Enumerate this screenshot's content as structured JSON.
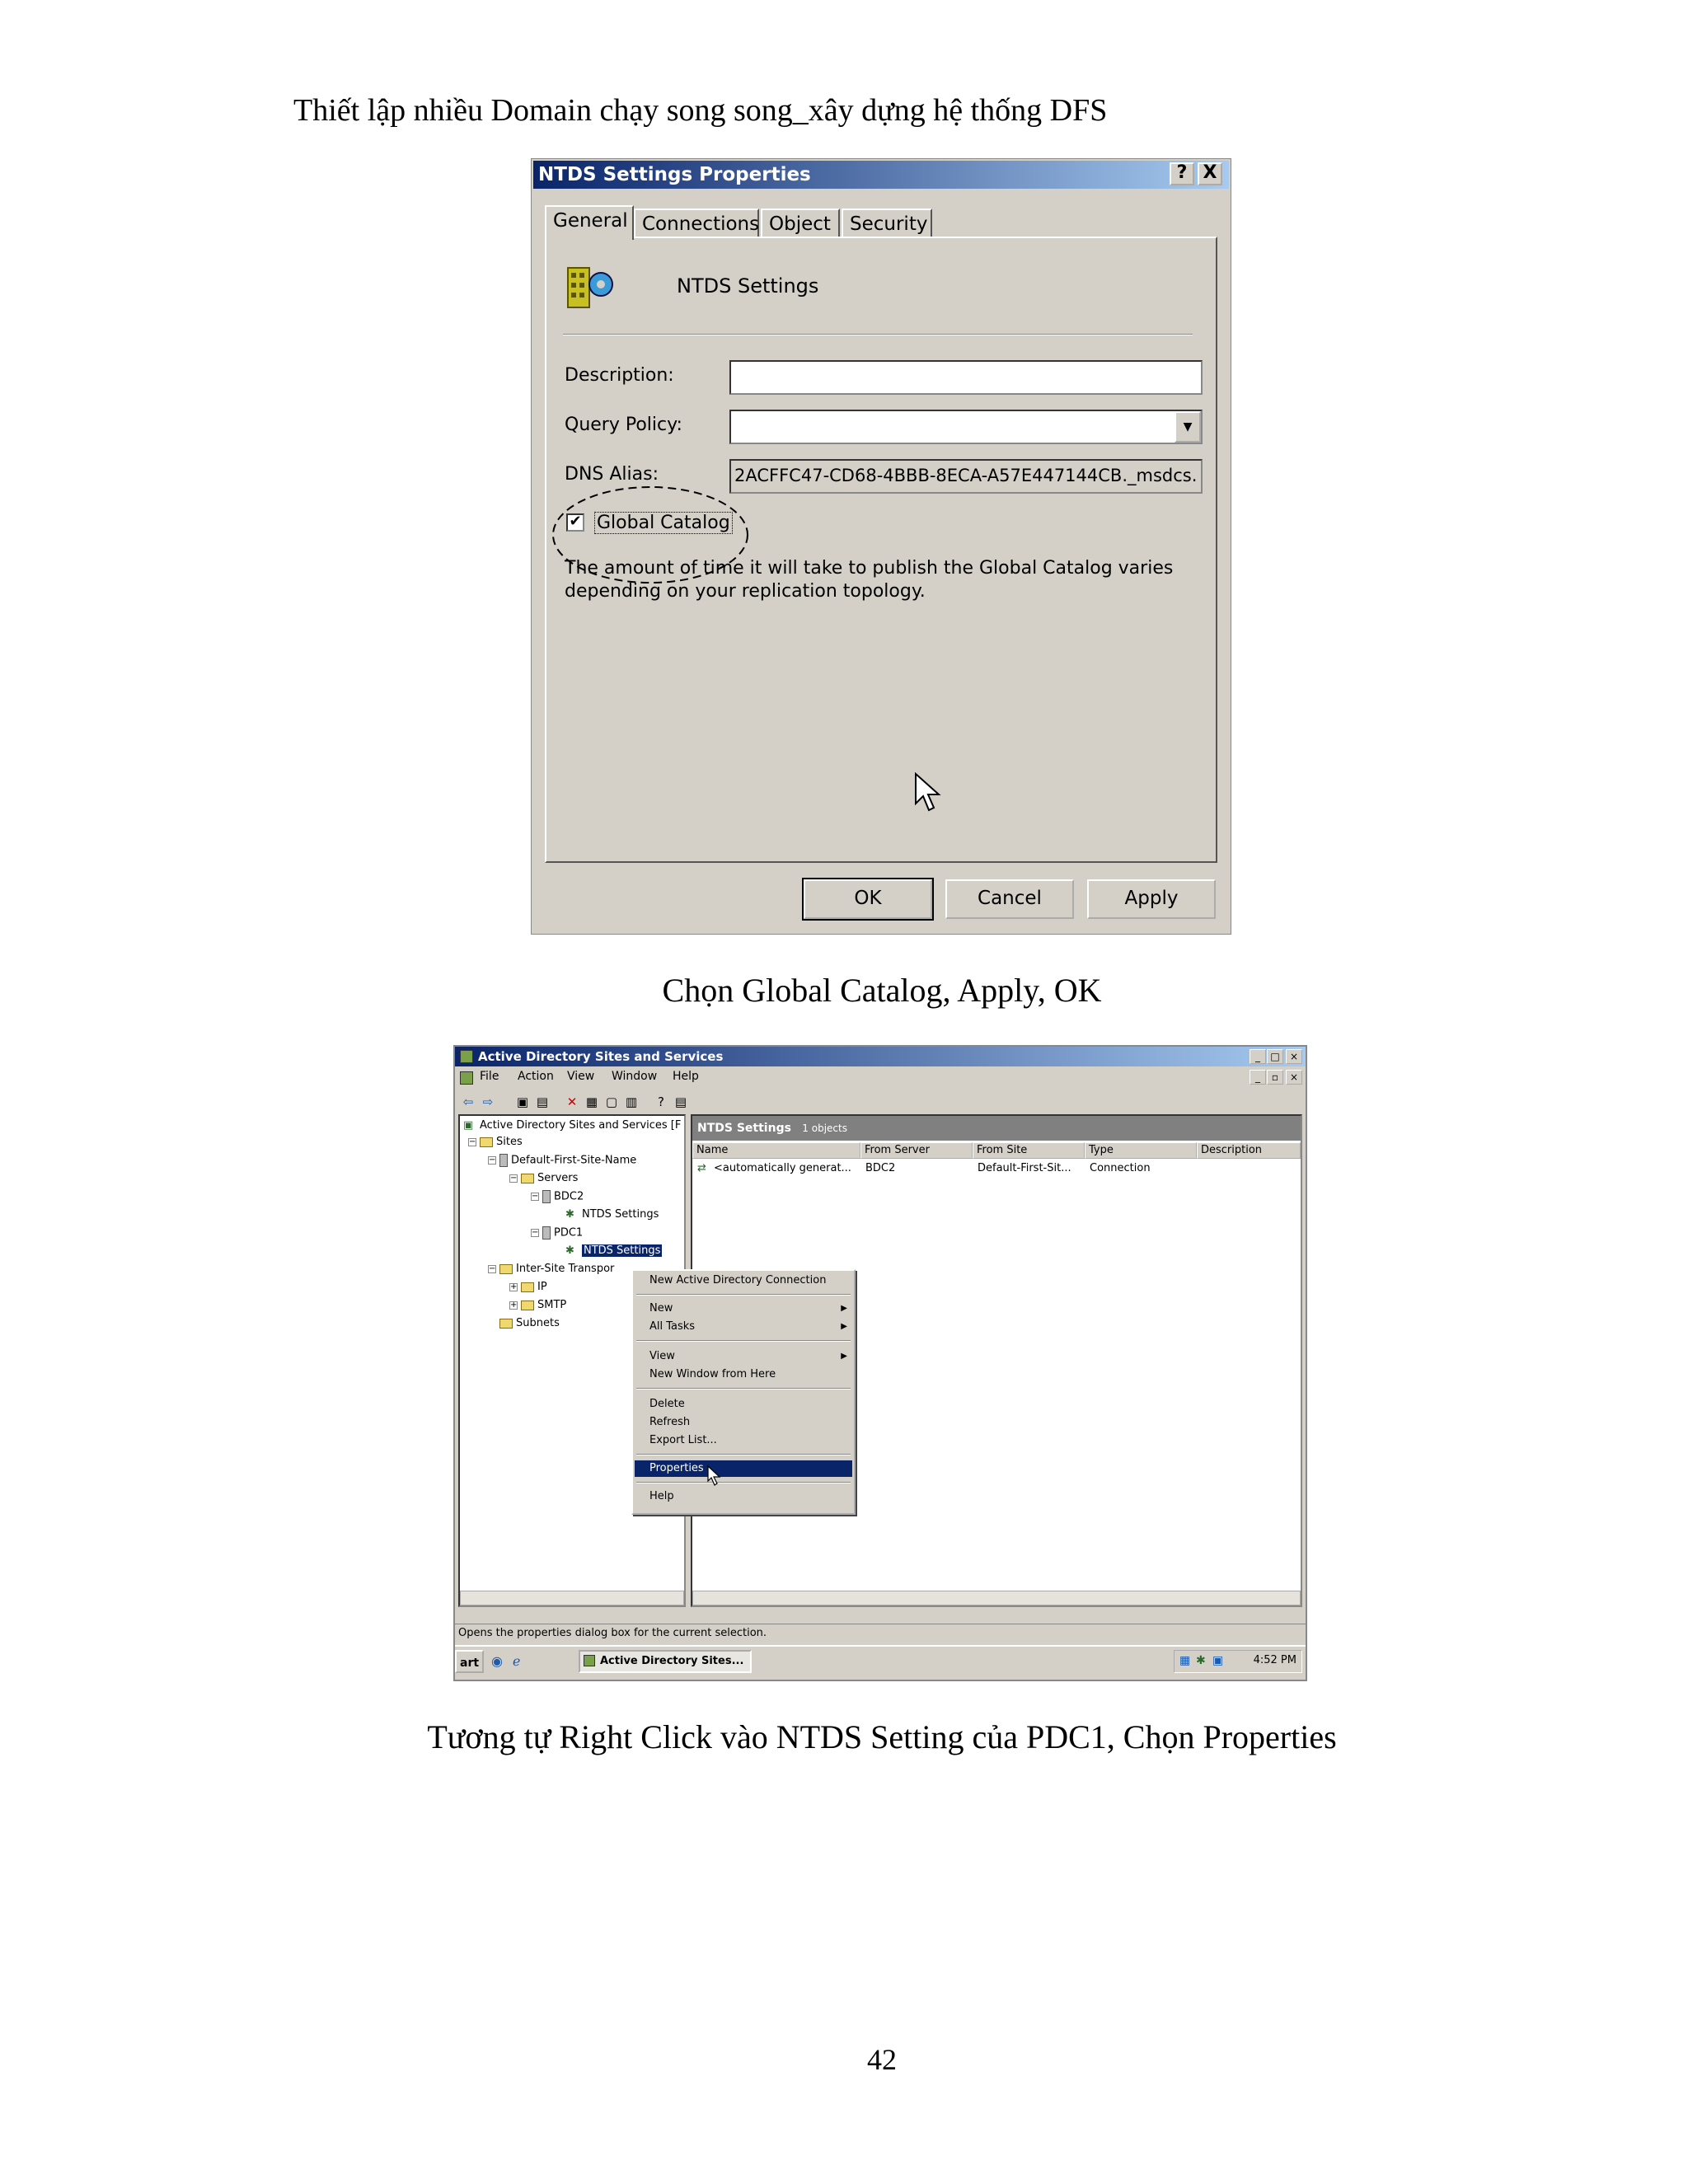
{
  "document": {
    "header": "Thiết lập nhiều Domain chạy song song_xây dựng hệ thống DFS",
    "caption1": "Chọn Global Catalog, Apply, OK",
    "caption2": "Tương tự Right Click vào NTDS Setting của PDC1, Chọn Properties",
    "page_number": "42"
  },
  "dialog1": {
    "title": "NTDS Settings Properties",
    "help_btn": "?",
    "close_btn": "X",
    "tabs": [
      "General",
      "Connections",
      "Object",
      "Security"
    ],
    "object_name": "NTDS Settings",
    "description_label": "Description:",
    "description_value": "",
    "query_policy_label": "Query Policy:",
    "query_policy_value": "",
    "dns_alias_label": "DNS Alias:",
    "dns_alias_value": "2ACFFC47-CD68-4BBB-8ECA-A57E447144CB._msdcs.",
    "global_catalog_label": "Global Catalog",
    "global_catalog_checked": true,
    "info_line1": "The amount of time it will take to publish the Global Catalog varies",
    "info_line2": "depending on your replication topology.",
    "ok": "OK",
    "cancel": "Cancel",
    "apply": "Apply"
  },
  "window2": {
    "title": "Active Directory Sites and Services",
    "menu": [
      "File",
      "Action",
      "View",
      "Window",
      "Help"
    ],
    "tree": {
      "root": "Active Directory Sites and Services [F",
      "sites": "Sites",
      "default_site": "Default-First-Site-Name",
      "servers": "Servers",
      "bdc2": "BDC2",
      "bdc2_ntds": "NTDS Settings",
      "pdc1": "PDC1",
      "pdc1_ntds": "NTDS Settings",
      "inter_site": "Inter-Site Transpor",
      "ip": "IP",
      "smtp": "SMTP",
      "subnets": "Subnets"
    },
    "right_header": "NTDS Settings",
    "right_count": "1 objects",
    "columns": [
      "Name",
      "From Server",
      "From Site",
      "Type",
      "Description"
    ],
    "row": {
      "name": "<automatically generat...",
      "from_server": "BDC2",
      "from_site": "Default-First-Sit...",
      "type": "Connection",
      "description": ""
    },
    "context_menu": [
      "New Active Directory Connection",
      "New",
      "All Tasks",
      "View",
      "New Window from Here",
      "Delete",
      "Refresh",
      "Export List...",
      "Properties",
      "Help"
    ],
    "status": "Opens the properties dialog box for the current selection.",
    "taskbar_start": "art",
    "taskbar_app": "Active Directory Sites...",
    "clock": "4:52 PM"
  }
}
